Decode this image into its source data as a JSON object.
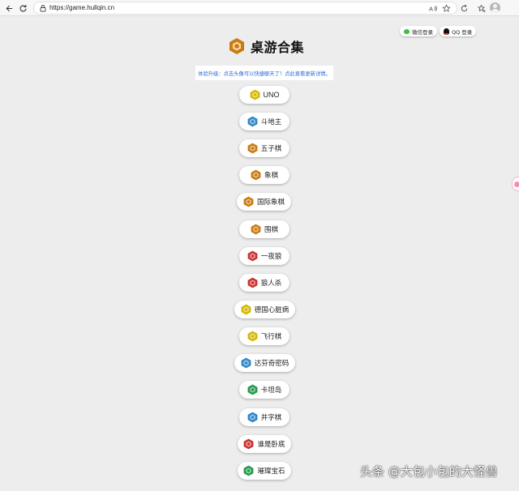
{
  "browser": {
    "url": "https://game.hullqin.cn",
    "icons": [
      "back-icon",
      "refresh-icon",
      "lock-icon",
      "read-aloud-icon",
      "favorite-icon",
      "refresh-extension-icon",
      "collections-icon",
      "profile-avatar"
    ]
  },
  "header": {
    "wechat_login": "微信登录",
    "qq_login": "QQ 登录",
    "title": "桌游合集",
    "notice": "体验升级：点击头像可以快捷聊天了！点此查看更新详情。"
  },
  "games": [
    {
      "label": "UNO",
      "color": "#d4b800"
    },
    {
      "label": "斗地主",
      "color": "#2e86c8"
    },
    {
      "label": "五子棋",
      "color": "#c97a12"
    },
    {
      "label": "象棋",
      "color": "#c97a12"
    },
    {
      "label": "国际象棋",
      "color": "#c97a12"
    },
    {
      "label": "围棋",
      "color": "#c97a12"
    },
    {
      "label": "一夜狼",
      "color": "#cc2f2f"
    },
    {
      "label": "狼人杀",
      "color": "#cc2f2f"
    },
    {
      "label": "德国心脏病",
      "color": "#d4b800"
    },
    {
      "label": "飞行棋",
      "color": "#d4b800"
    },
    {
      "label": "达芬奇密码",
      "color": "#2e86c8"
    },
    {
      "label": "卡坦岛",
      "color": "#1f9a4a"
    },
    {
      "label": "井字棋",
      "color": "#2e86c8"
    },
    {
      "label": "谁是卧底",
      "color": "#cc2f2f"
    },
    {
      "label": "璀璨宝石",
      "color": "#1f9a4a"
    }
  ],
  "watermark": "头条 @大包小包的大怪兽",
  "colors": {
    "title_logo": "#c97a12",
    "notice_text": "#2a6fd6",
    "background": "#ededed"
  }
}
